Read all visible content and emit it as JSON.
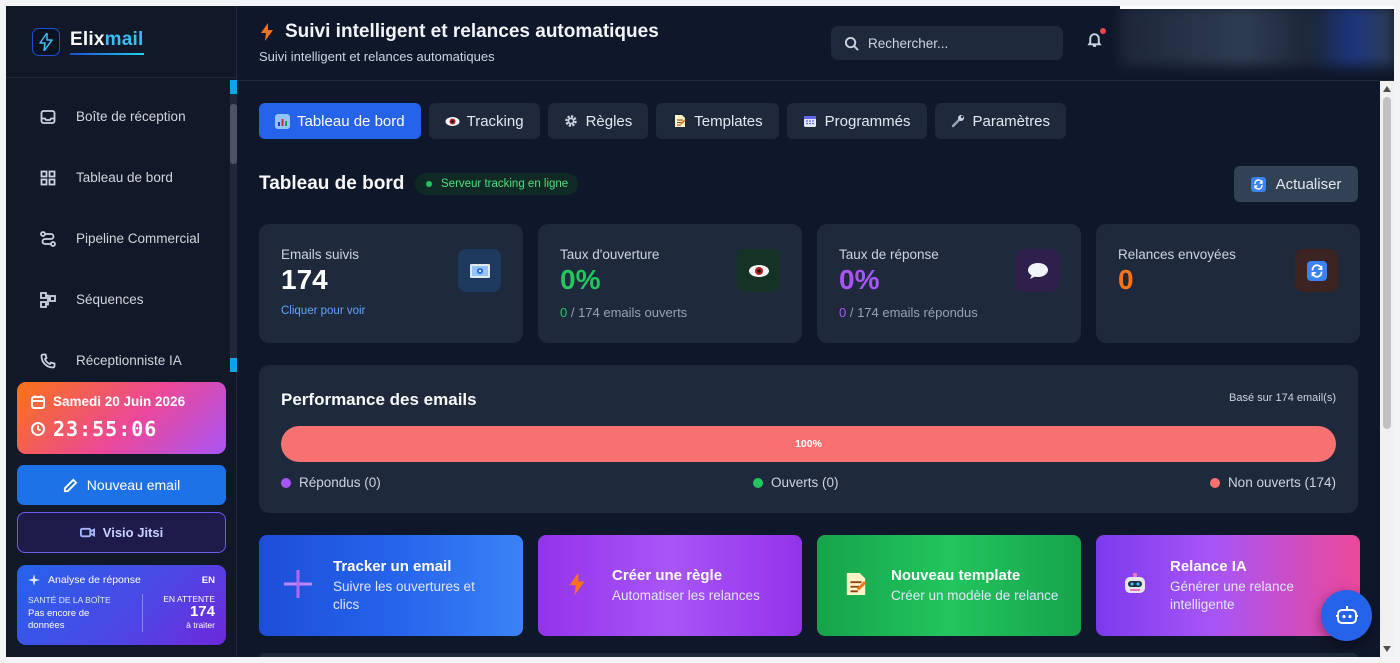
{
  "brand": {
    "name_part1": "Elix",
    "name_part2": "mail"
  },
  "sidebar": {
    "items": [
      {
        "label": "Boîte de réception",
        "icon": "inbox-icon"
      },
      {
        "label": "Tableau de bord",
        "icon": "grid-icon"
      },
      {
        "label": "Pipeline Commercial",
        "icon": "route-icon"
      },
      {
        "label": "Séquences",
        "icon": "flow-icon"
      },
      {
        "label": "Réceptionniste IA",
        "icon": "phone-icon"
      }
    ],
    "date": "Samedi 20 Juin 2026",
    "time": "23:55:06",
    "new_email": "Nouveau email",
    "visio": "Visio Jitsi",
    "analyse": {
      "title": "Analyse de réponse",
      "lang": "EN",
      "health_label": "SANTÉ DE LA BOÎTE",
      "health_value": "Pas encore de données",
      "pending_label": "EN ATTENTE",
      "pending_count": "174",
      "pending_sub": "à traiter"
    }
  },
  "header": {
    "title": "Suivi intelligent et relances automatiques",
    "subtitle": "Suivi intelligent et relances automatiques",
    "search_placeholder": "Rechercher..."
  },
  "tabs": [
    {
      "label": "Tableau de bord",
      "icon": "chart-icon",
      "active": true
    },
    {
      "label": "Tracking",
      "icon": "eye-icon",
      "active": false
    },
    {
      "label": "Règles",
      "icon": "gear-icon",
      "active": false
    },
    {
      "label": "Templates",
      "icon": "document-icon",
      "active": false
    },
    {
      "label": "Programmés",
      "icon": "calendar-icon",
      "active": false
    },
    {
      "label": "Paramètres",
      "icon": "wrench-icon",
      "active": false
    }
  ],
  "dashboard": {
    "title": "Tableau de bord",
    "status": "Serveur tracking en ligne",
    "refresh": "Actualiser"
  },
  "stats": [
    {
      "label": "Emails suivis",
      "value": "174",
      "link": "Cliquer pour voir",
      "color": "#ffffff"
    },
    {
      "label": "Taux d'ouverture",
      "value": "0%",
      "sub_num": "0",
      "sub_text": " / 174 emails ouverts",
      "color": "#22c55e"
    },
    {
      "label": "Taux de réponse",
      "value": "0%",
      "sub_num": "0",
      "sub_text": " / 174 emails répondus",
      "color": "#a855f7"
    },
    {
      "label": "Relances envoyées",
      "value": "0",
      "color": "#f97316"
    }
  ],
  "performance": {
    "title": "Performance des emails",
    "basis": "Basé sur 174 email(s)",
    "bar_label": "100%",
    "bar_fraction": 1.0,
    "legend": [
      {
        "label": "Répondus (0)",
        "color": "#a855f7"
      },
      {
        "label": "Ouverts (0)",
        "color": "#22c55e"
      },
      {
        "label": "Non ouverts (174)",
        "color": "#f87171"
      }
    ]
  },
  "actions": [
    {
      "title": "Tracker un email",
      "sub": "Suivre les ouvertures et clics"
    },
    {
      "title": "Créer une règle",
      "sub": "Automatiser les relances"
    },
    {
      "title": "Nouveau template",
      "sub": "Créer un modèle de relance"
    },
    {
      "title": "Relance IA",
      "sub": "Générer une relance intelligente"
    }
  ]
}
